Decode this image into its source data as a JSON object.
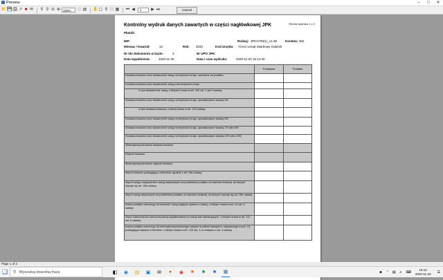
{
  "window": {
    "title": "Preview",
    "min": "–",
    "max": "□",
    "close": "✕"
  },
  "toolbar": {
    "zoom": "100%",
    "page": "1",
    "cancel": "Cancel"
  },
  "doc": {
    "page_no": "Strona wydruku 1 z 2",
    "title": "Kontrolny wydruk danych zawartych w części nagłówkowej JPK",
    "platnik_lbl": "Płatnik:",
    "nip_lbl": "NIP:",
    "rodzaj_lbl": "Rodzaj:",
    "rodzaj_val": "JPK/V7M(1)_v1-2E",
    "korekta_lbl": "Korekta:",
    "korekta_val": "NIE",
    "miesiac_lbl": "Miesiąc / Kwartał:",
    "miesiac_val": "10",
    "rok_lbl": "Rok:",
    "rok_val": "2020",
    "kod_lbl": "Kod Urzędu:",
    "kod_val": "Trzeci Urząd Skarbowy Gdańsk",
    "nr_lbl": "Nr ide dokumentu w bazie:",
    "nr_val": "3",
    "upo_lbl": "Nr UPO JPK:",
    "data_lbl": "Data wypełnienia:",
    "data_val": "2020-11-20",
    "wydruk_lbl": "Data / czas wydruku:",
    "wydruk_val": "2020-11-20 16:14:30"
  },
  "table": {
    "headers": [
      "Podstawa",
      "Podatek"
    ],
    "rows": [
      {
        "label": "Dostawa towarów oraz świadczenie usług na terytorium kraju, zwolnione od podatku",
        "sub": false,
        "gray": false
      },
      {
        "label": "Dostawa towarów oraz świadczenie usług poza terytorium kraju",
        "sub": false,
        "gray": false
      },
      {
        "label": "w tym świadczenie usług, o których mowa w art. 100 ust. 1 pkt 4 ustawy",
        "sub": true,
        "gray": false
      },
      {
        "label": "Dostawa towarów oraz świadczenie usług na terytorium kraju, opodatkowane stawką 0%",
        "sub": false,
        "gray": false
      },
      {
        "label": "w tym dostawa towarów, o której mowa w art. 129 ustawy",
        "sub": true,
        "gray": false
      },
      {
        "label": "Dostawa towarów oraz świadczenie usług na terytorium kraju, opodatkowane stawką 5%",
        "sub": false,
        "gray": false
      },
      {
        "label": "Dostawa towarów oraz świadczenie usług na terytorium kraju, opodatkowane stawką 7% albo 8%",
        "sub": false,
        "gray": false
      },
      {
        "label": "Dostawa towarów oraz świadczenie usług na terytorium kraju, opodatkowane stawką 22% albo 23%",
        "sub": false,
        "gray": false
      },
      {
        "label": "Wewnątrzwspólnotowa dostawa towarów",
        "sub": false,
        "gray": true
      },
      {
        "label": "Eksport towarów",
        "sub": false,
        "gray": true
      },
      {
        "label": "Wewnątrzwspólnotowe nabycie towarów",
        "sub": false,
        "gray": false
      },
      {
        "label": "Import towarów podlegający rozliczeniu zgodnie z art. 33a ustawy",
        "sub": false,
        "gray": false
      },
      {
        "label": "Import usług z wyłączeniem usług nabywanych od podatników podatku od wartości dodanej, do których stosuje się art. 28b ustawy",
        "sub": false,
        "gray": false
      },
      {
        "label": "Import usług nabywanych od podatników podatku od wartości dodanej, do których stosuje się art. 28b ustawy",
        "sub": false,
        "gray": false
      },
      {
        "label": "Kwota podatku należnego od towarów i usług objętych spisem z natury, o którym mowa w art. 14 ust. 5 ustawy",
        "sub": false,
        "gray": false
      },
      {
        "label": "Zwrot odliczonej lub zwróconej kwoty wydatkowanej na zakup kas rejestrujących, o którym mowa w art. 111 ust. 6 ustawy",
        "sub": false,
        "gray": false
      },
      {
        "label": "Kwota podatku należnego od wewnątrzwspólnotowego nabycia środków transportu, wykazanego w poz. 24, podlegająca wpłacie w terminie, o którym mowa w art. 103 ust. 3, w związku z ust. 4 ustawy",
        "sub": false,
        "gray": false
      }
    ]
  },
  "status": {
    "page_info": "Page 1 of 2"
  },
  "taskbar": {
    "search_placeholder": "Wyszukaj dowolną frazę",
    "time": "16:14",
    "date": "2020-11-20"
  }
}
